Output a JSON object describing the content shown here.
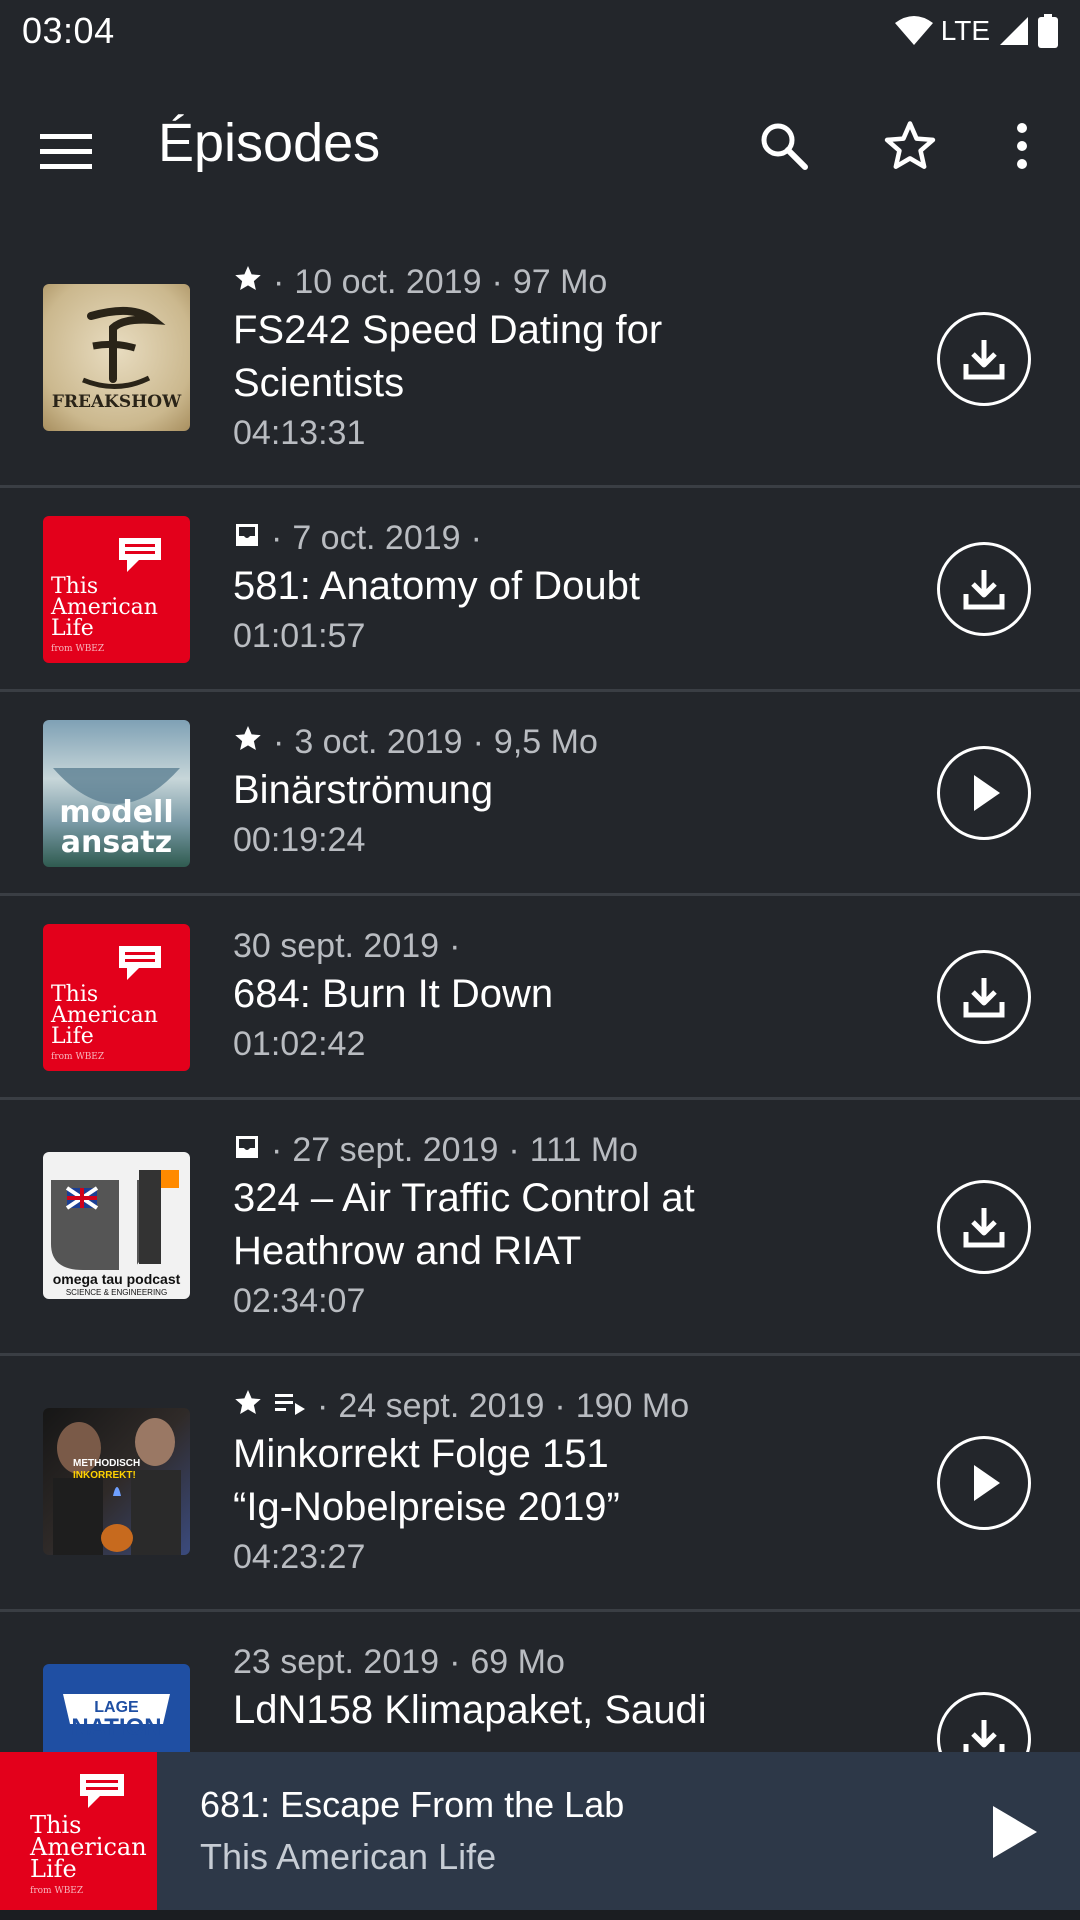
{
  "status_bar": {
    "time": "03:04",
    "network": "LTE"
  },
  "app_bar": {
    "title": "Épisodes",
    "icons": [
      "menu-icon",
      "search-icon",
      "star-outline-icon",
      "more-vert-icon"
    ]
  },
  "episodes": [
    {
      "podcast": "Freak Show",
      "cover_text": "FREAKSHOW",
      "flags": [
        "star-icon"
      ],
      "date": "10 oct. 2019",
      "size": "97 Mo",
      "title_line1": "FS242 Speed Dating for",
      "title_line2": "Scientists",
      "duration": "04:13:31",
      "action": "download-icon"
    },
    {
      "podcast": "This American Life",
      "flags": [
        "inbox-icon"
      ],
      "date": "7 oct. 2019",
      "size": "",
      "title_line1": "581: Anatomy of Doubt",
      "duration": "01:01:57",
      "action": "download-icon"
    },
    {
      "podcast": "Modellansatz",
      "cover_text_1": "modell",
      "cover_text_2": "ansatz",
      "flags": [
        "star-icon"
      ],
      "date": "3 oct. 2019",
      "size": "9,5 Mo",
      "title_line1": "Binärströmung",
      "duration": "00:19:24",
      "action": "play-icon"
    },
    {
      "podcast": "This American Life",
      "flags": [],
      "date": "30 sept. 2019",
      "size": "",
      "title_line1": "684: Burn It Down",
      "duration": "01:02:42",
      "action": "download-icon"
    },
    {
      "podcast": "omega tau podcast",
      "cover_text_1": "omega tau podcast",
      "cover_text_2": "SCIENCE & ENGINEERING",
      "flags": [
        "inbox-icon"
      ],
      "date": "27 sept. 2019",
      "size": "111 Mo",
      "title_line1": "324 – Air Traffic Control at",
      "title_line2": "Heathrow and RIAT",
      "duration": "02:34:07",
      "action": "download-icon"
    },
    {
      "podcast": "Methodisch Inkorrekt",
      "cover_text_1": "METHODISCH",
      "cover_text_2": "INKORREKT!",
      "flags": [
        "star-icon",
        "queue-icon"
      ],
      "date": "24 sept. 2019",
      "size": "190 Mo",
      "title_line1": "Minkorrekt Folge 151",
      "title_line2": "“Ig-Nobelpreise 2019”",
      "duration": "04:23:27",
      "action": "play-icon"
    },
    {
      "podcast": "Lage der Nation",
      "cover_text_1": "LAGE",
      "cover_text_2": "NATION",
      "flags": [],
      "date": "23 sept. 2019",
      "size": "69 Mo",
      "title_line1": "LdN158 Klimapaket, Saudi",
      "action": "download-icon"
    }
  ],
  "tal_cover": {
    "line1": "This",
    "line2": "American",
    "line3": "Life",
    "line4": "from WBEZ"
  },
  "mini_player": {
    "episode_title": "681: Escape From the Lab",
    "podcast_title": "This American Life",
    "control": "play-icon"
  },
  "colors": {
    "background": "#23262b",
    "divider": "#3a3e44",
    "mini_player": "#2d3848",
    "tal_red": "#e3001b",
    "secondary_text": "#b9bcc1"
  }
}
